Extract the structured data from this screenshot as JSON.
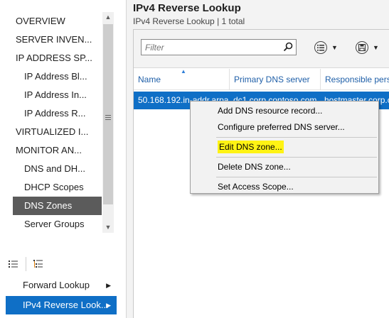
{
  "nav": {
    "tree": [
      {
        "label": "OVERVIEW",
        "level": 0,
        "selected": false
      },
      {
        "label": "SERVER INVEN...",
        "level": 0,
        "selected": false
      },
      {
        "label": "IP ADDRESS SP...",
        "level": 0,
        "selected": false
      },
      {
        "label": "IP Address Bl...",
        "level": 1,
        "selected": false
      },
      {
        "label": "IP Address In...",
        "level": 1,
        "selected": false
      },
      {
        "label": "IP Address R...",
        "level": 1,
        "selected": false
      },
      {
        "label": "VIRTUALIZED I...",
        "level": 0,
        "selected": false
      },
      {
        "label": "MONITOR AN...",
        "level": 0,
        "selected": false
      },
      {
        "label": "DNS and DH...",
        "level": 1,
        "selected": false
      },
      {
        "label": "DHCP Scopes",
        "level": 1,
        "selected": false
      },
      {
        "label": "DNS Zones",
        "level": 1,
        "selected": true
      },
      {
        "label": "Server Groups",
        "level": 1,
        "selected": false
      }
    ],
    "bottom": {
      "forward_label": "Forward Lookup",
      "reverse_label": "IPv4 Reverse Look..."
    }
  },
  "main": {
    "title": "IPv4 Reverse Lookup",
    "subtitle": "IPv4 Reverse Lookup | 1 total",
    "filter_placeholder": "Filter",
    "columns": [
      "Name",
      "Primary DNS server",
      "Responsible pers"
    ],
    "rows": [
      {
        "name": "50.168.192.in-addr.arpa",
        "primary": "dc1.corp.contoso.com",
        "responsible": "hostmaster.corp.co"
      }
    ]
  },
  "context_menu": {
    "items": [
      {
        "label": "Add DNS resource record...",
        "highlighted": false,
        "separator_after": false
      },
      {
        "label": "Configure preferred DNS server...",
        "highlighted": false,
        "separator_after": true
      },
      {
        "label": "Edit DNS zone...",
        "highlighted": true,
        "separator_after": true
      },
      {
        "label": "Delete DNS zone...",
        "highlighted": false,
        "separator_after": true
      },
      {
        "label": "Set Access Scope...",
        "highlighted": false,
        "separator_after": false
      }
    ]
  },
  "colors": {
    "selection": "#0f6fc6",
    "nav_selected": "#5b5b5b",
    "highlight": "#fff314",
    "header_text": "#1f5fa8"
  }
}
